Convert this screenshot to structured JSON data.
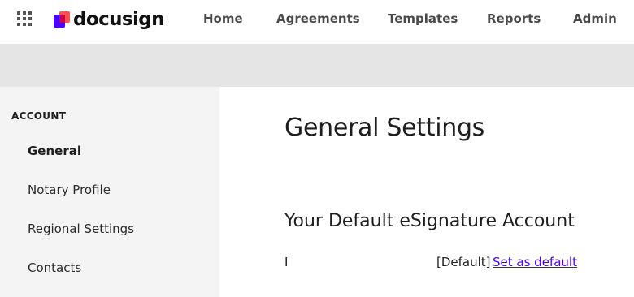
{
  "header": {
    "logo_text": "docusign",
    "nav": [
      {
        "label": "Home"
      },
      {
        "label": "Agreements"
      },
      {
        "label": "Templates"
      },
      {
        "label": "Reports"
      },
      {
        "label": "Admin"
      }
    ]
  },
  "sidebar": {
    "section_label": "ACCOUNT",
    "items": [
      {
        "label": "General",
        "active": true
      },
      {
        "label": "Notary Profile",
        "active": false
      },
      {
        "label": "Regional Settings",
        "active": false
      },
      {
        "label": "Contacts",
        "active": false
      }
    ]
  },
  "main": {
    "title": "General Settings",
    "section_title": "Your Default eSignature Account",
    "account_row": {
      "account_name": "I",
      "default_tag": "[Default]",
      "set_default_link": "Set as default"
    }
  },
  "colors": {
    "brand_purple": "#4c00ff",
    "logo_red": "#ff5252",
    "subbar_bg": "#e5e5e5",
    "sidebar_bg": "#f4f4f4",
    "link": "#4c00ff"
  },
  "icons": {
    "apps": "apps-grid-icon",
    "logo": "docusign-logo-icon"
  }
}
